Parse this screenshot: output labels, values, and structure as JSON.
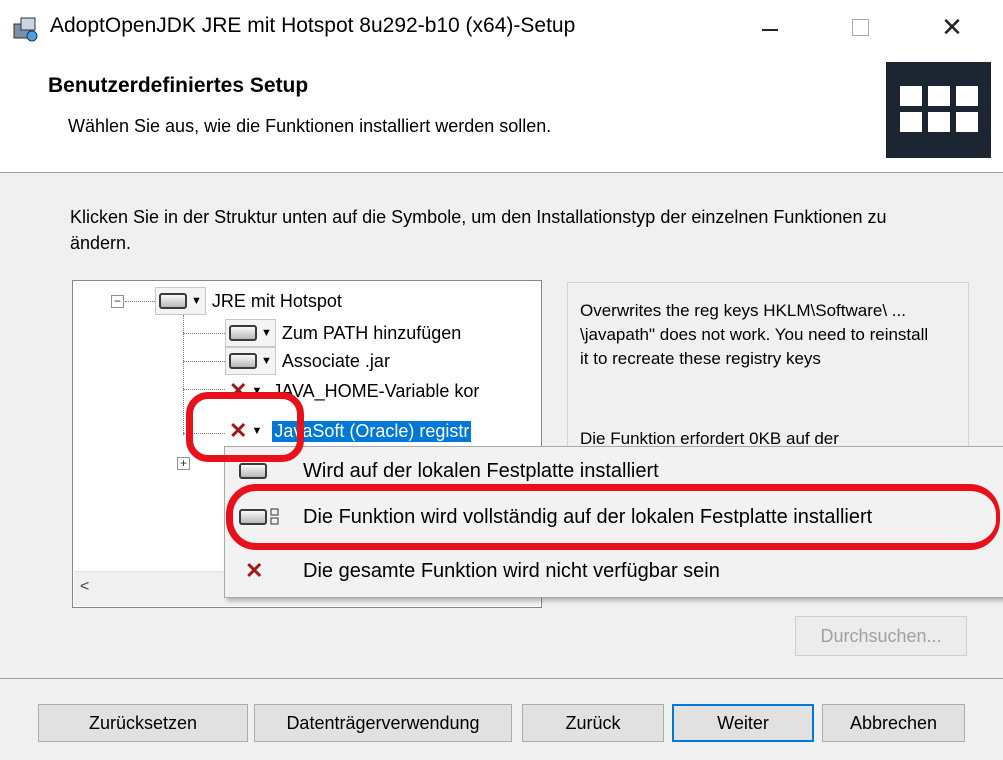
{
  "window": {
    "title": "AdoptOpenJDK JRE mit Hotspot 8u292-b10 (x64)-Setup",
    "icon": "installer-icon"
  },
  "header": {
    "title": "Benutzerdefiniertes Setup",
    "subtitle": "Wählen Sie aus, wie die Funktionen installiert werden sollen."
  },
  "instructions": "Klicken Sie in der Struktur unten auf die Symbole, um den Installationstyp der einzelnen Funktionen zu ändern.",
  "tree": {
    "items": [
      {
        "label": "JRE mit Hotspot",
        "state": "installed"
      },
      {
        "label": "Zum PATH hinzufügen",
        "state": "installed"
      },
      {
        "label": "Associate .jar",
        "state": "installed"
      },
      {
        "label": "JAVA_HOME-Variable kor",
        "state": "unavailable"
      },
      {
        "label": "JavaSoft (Oracle) registr",
        "state": "unavailable"
      }
    ]
  },
  "description": {
    "text": "Overwrites the reg keys HKLM\\Software\\ ... \\javapath\" does not work. You need to reinstall it to recreate these registry keys",
    "requirement": "Die Funktion erfordert 0KB auf der"
  },
  "popup_menu": {
    "items": [
      {
        "label": "Wird auf der lokalen Festplatte installiert",
        "icon": "hard-drive-icon"
      },
      {
        "label": "Die Funktion wird vollständig auf der lokalen Festplatte installiert",
        "icon": "hard-drive-full-icon"
      },
      {
        "label": "Die gesamte Funktion wird nicht verfügbar sein",
        "icon": "red-x-icon"
      }
    ]
  },
  "buttons": {
    "browse": "Durchsuchen...",
    "reset": "Zurücksetzen",
    "disk_usage": "Datenträgerverwendung",
    "back": "Zurück",
    "next": "Weiter",
    "cancel": "Abbrechen"
  },
  "colors": {
    "selection": "#0078d7",
    "annotation": "#e8101a",
    "unavailable_x": "#a01818"
  }
}
